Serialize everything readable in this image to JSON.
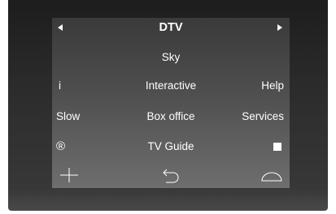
{
  "header": {
    "prev_icon": "triangle-left-icon",
    "title": "DTV",
    "next_icon": "triangle-right-icon"
  },
  "rows": [
    {
      "left": "",
      "center": "Sky",
      "right": ""
    },
    {
      "left": "i",
      "center": "Interactive",
      "right": "Help"
    },
    {
      "left": "Slow",
      "center": "Box office",
      "right": "Services"
    },
    {
      "left": "®",
      "center": "TV Guide",
      "right": ""
    }
  ],
  "row4_right_icon": "stop-square-icon",
  "bottom_icons": [
    "plus-icon",
    "back-arrow-icon",
    "dome-icon"
  ],
  "colors": {
    "text": "#ffffff",
    "screen_top": "#3a3a3a",
    "screen_bottom": "#6e6e6e",
    "frame": "#2b2b2b"
  }
}
